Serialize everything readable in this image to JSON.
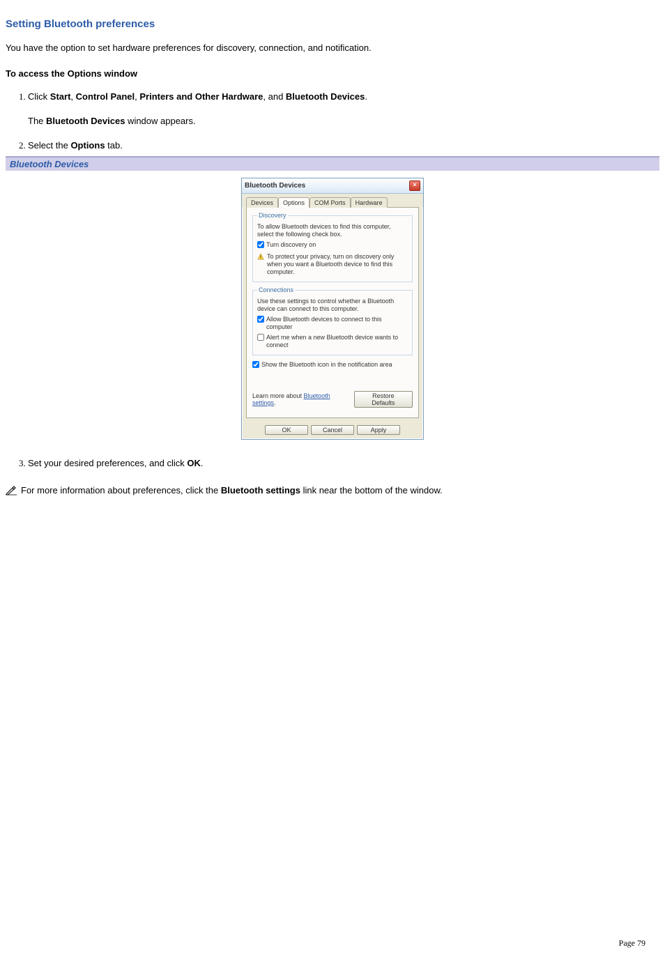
{
  "heading": "Setting Bluetooth preferences",
  "intro": "You have the option to set hardware preferences for discovery, connection, and notification.",
  "access_heading": "To access the Options window",
  "steps": {
    "s1_prefix": "Click ",
    "s1_b1": "Start",
    "s1_sep1": ", ",
    "s1_b2": "Control Panel",
    "s1_sep2": ", ",
    "s1_b3": "Printers and Other Hardware",
    "s1_sep3": ", and ",
    "s1_b4": "Bluetooth Devices",
    "s1_suffix": ".",
    "s1_desc_pre": "The ",
    "s1_desc_b": "Bluetooth Devices",
    "s1_desc_post": " window appears.",
    "s2_pre": "Select the ",
    "s2_b": "Options",
    "s2_post": " tab.",
    "s3_pre": "Set your desired preferences, and click ",
    "s3_b": "OK",
    "s3_post": "."
  },
  "banner": "Bluetooth Devices",
  "dialog": {
    "title": "Bluetooth Devices",
    "close_glyph": "×",
    "tabs": [
      "Devices",
      "Options",
      "COM Ports",
      "Hardware"
    ],
    "discovery": {
      "legend": "Discovery",
      "text": "To allow Bluetooth devices to find this computer, select the following check box.",
      "cb1": "Turn discovery on",
      "warn": "To protect your privacy, turn on discovery only when you want a Bluetooth device to find this computer."
    },
    "connections": {
      "legend": "Connections",
      "text": "Use these settings to control whether a Bluetooth device can connect to this computer.",
      "cb1": "Allow Bluetooth devices to connect to this computer",
      "cb2": "Alert me when a new Bluetooth device wants to connect"
    },
    "show_icon": "Show the Bluetooth icon in the notification area",
    "learn_pre": "Learn more about ",
    "learn_link": "Bluetooth settings",
    "restore": "Restore Defaults",
    "ok": "OK",
    "cancel": "Cancel",
    "apply": "Apply"
  },
  "note_pre": "For more information about preferences, click the ",
  "note_b": "Bluetooth settings",
  "note_post": " link near the bottom of the window.",
  "page_label": "Page 79"
}
